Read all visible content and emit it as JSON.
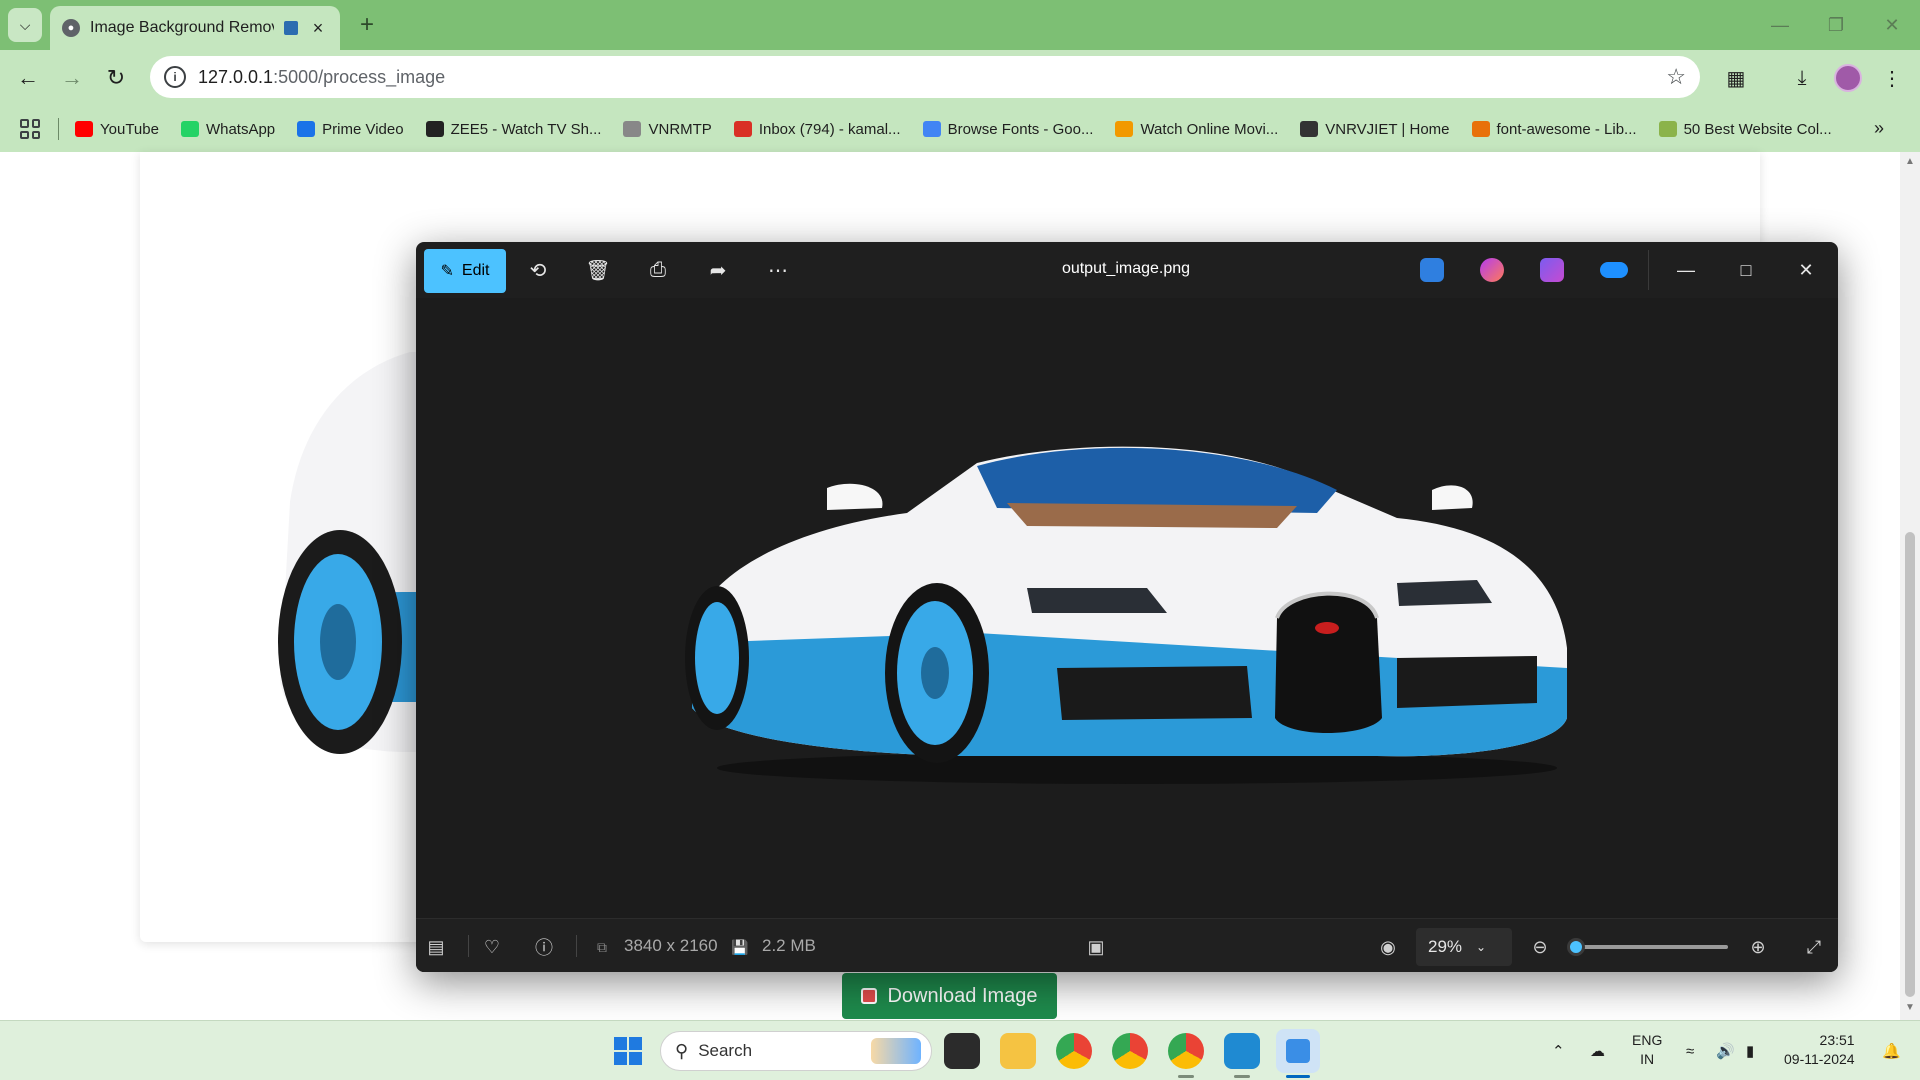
{
  "browser": {
    "tab": {
      "title": "Image Background Remover"
    },
    "url": {
      "host": "127.0.0.1",
      "path": ":5000/process_image"
    },
    "bookmarks": [
      {
        "label": "YouTube",
        "color": "#ff0000"
      },
      {
        "label": "WhatsApp",
        "color": "#25d366"
      },
      {
        "label": "Prime Video",
        "color": "#1a73e8"
      },
      {
        "label": "ZEE5 - Watch TV Sh...",
        "color": "#222222"
      },
      {
        "label": "VNRMTP",
        "color": "#888888"
      },
      {
        "label": "Inbox (794) - kamal...",
        "color": "#d93025"
      },
      {
        "label": "Browse Fonts - Goo...",
        "color": "#4285f4"
      },
      {
        "label": "Watch Online Movi...",
        "color": "#f29900"
      },
      {
        "label": "VNRVJIET | Home",
        "color": "#333333"
      },
      {
        "label": "font-awesome - Lib...",
        "color": "#e8710a"
      },
      {
        "label": "50 Best Website Col...",
        "color": "#8bb34a"
      }
    ]
  },
  "page": {
    "download_label": "Download Image"
  },
  "viewer": {
    "edit_label": "Edit",
    "filename": "output_image.png",
    "dimensions": "3840 x 2160",
    "filesize": "2.2 MB",
    "zoom": "29%",
    "zoom_level": 0.05,
    "accent": "#4cc2ff"
  },
  "taskbar": {
    "search_label": "Search",
    "lang_top": "ENG",
    "lang_bottom": "IN",
    "time": "23:51",
    "date": "09-11-2024"
  }
}
